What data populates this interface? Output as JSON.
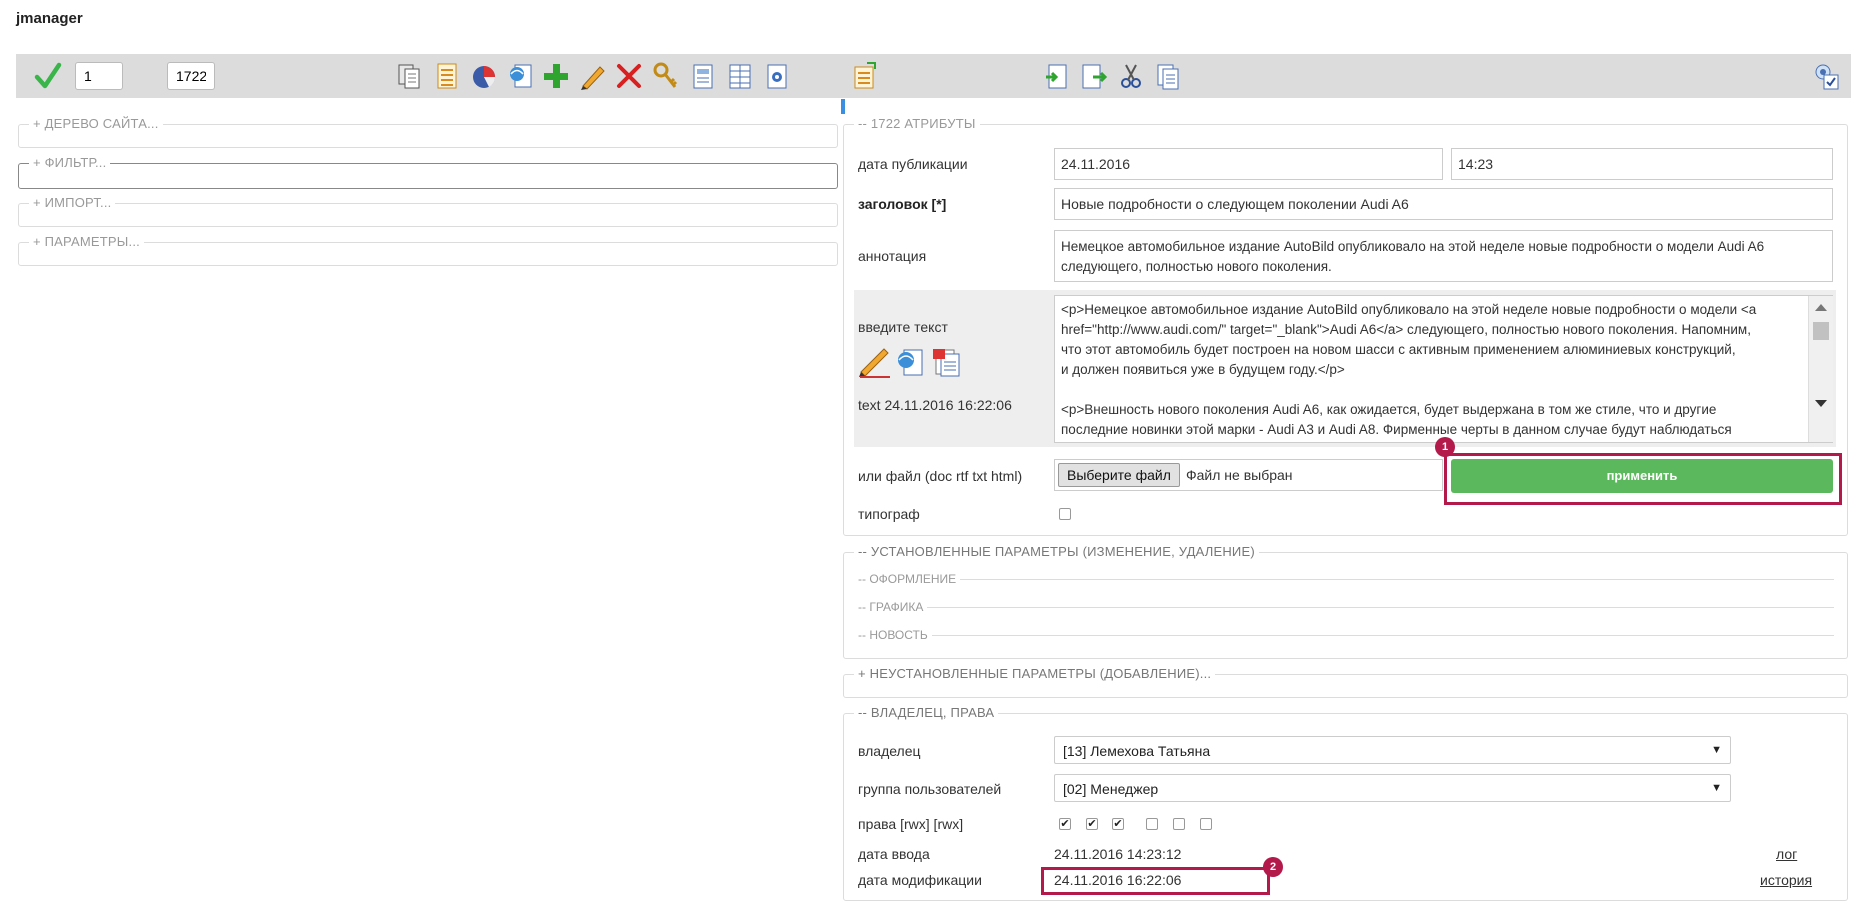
{
  "app": {
    "title": "jmanager"
  },
  "toolbar": {
    "page_input": "1",
    "id_input": "1722",
    "icons": [
      "copy-icon",
      "list-icon",
      "chart-icon",
      "web-page-icon",
      "add-icon",
      "edit-icon",
      "delete-icon",
      "keys-icon",
      "form-icon",
      "table-icon",
      "settings-doc-icon",
      "export-icon",
      "move-in-icon",
      "move-out-icon",
      "cut-icon",
      "paste-icon",
      "admin-icon"
    ]
  },
  "left_panels": {
    "tree": "+ ДЕРЕВО САЙТА...",
    "filter": "+ ФИЛЬТР...",
    "import": "+ ИМПОРТ...",
    "params": "+ ПАРАМЕТРЫ..."
  },
  "attributes": {
    "legend": "-- 1722 АТРИБУТЫ",
    "publish_date_label": "дата публикации",
    "publish_date": "24.11.2016",
    "publish_time": "14:23",
    "title_label": "заголовок  [*]",
    "title_value": "Новые подробности о следующем поколении Audi A6",
    "annotation_label": "аннотация",
    "annotation_value": "Немецкое автомобильное издание AutoBild опубликовало на этой неделе новые подробности о модели Audi A6 следующего, полностью нового поколения.",
    "text_label": "введите текст",
    "text_timestamp": "text 24.11.2016 16:22:06",
    "text_value_line1": "<p>Немецкое автомобильное издание AutoBild опубликовало на этой неделе новые подробности о модели <a",
    "text_value_line2": "href=\"http://www.audi.com/\" target=\"_blank\">Audi A6</a> следующего, полностью нового поколения. Напомним,",
    "text_value_line3": "что этот автомобиль будет построен на новом шасси с активным применением алюминиевых конструкций,",
    "text_value_line4": "и должен появиться уже в будущем году.</p>",
    "text_value_line5": "<p>Внешность нового поколения Audi A6, как ожидается, будет выдержана в том же стиле, что и другие",
    "text_value_line6": "последние новинки этой марки - Audi A3 и Audi A8. Фирменные черты в данном случае будут наблюдаться",
    "file_label": "или файл (doc rtf txt html)",
    "file_button": "Выберите файл",
    "file_status": "Файл не выбран",
    "apply_button": "применить",
    "typograph_label": "типограф",
    "editor_icons": [
      "pencil-editor-icon",
      "web-editor-icon",
      "word-import-icon"
    ]
  },
  "set_params": {
    "legend": "-- УСТАНОВЛЕННЫЕ ПАРАМЕТРЫ (ИЗМЕНЕНИЕ, УДАЛЕНИЕ)",
    "groups": [
      "-- ОФОРМЛЕНИЕ",
      "-- ГРАФИКА",
      "-- НОВОСТЬ"
    ]
  },
  "unset_params": {
    "legend": "+ НЕУСТАНОВЛЕННЫЕ ПАРАМЕТРЫ (ДОБАВЛЕНИЕ)..."
  },
  "owner": {
    "legend": "-- ВЛАДЕЛЕЦ, ПРАВА",
    "owner_label": "владелец",
    "owner_value": "[13] Лемехова Татьяна",
    "group_label": "группа пользователей",
    "group_value": "[02] Менеджер",
    "rights_label": "права [rwx] [rwx]",
    "rights": [
      true,
      true,
      true,
      false,
      false,
      false
    ],
    "created_label": "дата ввода",
    "created_value": "24.11.2016 14:23:12",
    "log_link": "лог",
    "modified_label": "дата модификации",
    "modified_value": "24.11.2016 16:22:06",
    "history_link": "история"
  },
  "annotations": {
    "badge1": "1",
    "badge2": "2"
  },
  "colors": {
    "accent_green": "#5cb85c",
    "highlight": "#b3194a",
    "toolbar_bg": "#dcdcdc"
  }
}
